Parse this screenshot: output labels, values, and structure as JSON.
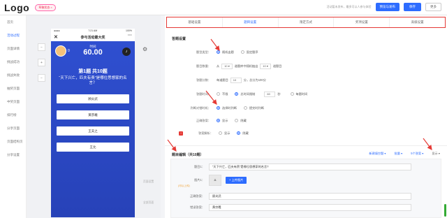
{
  "header": {
    "logo": "Logo",
    "draft_badge": "草稿状态 ×",
    "save_note": "活动暂未发布，最多可以人参与体验",
    "preview_publish": "预览与发布",
    "save": "保存",
    "more": "更多"
  },
  "sidebar": {
    "items": [
      {
        "label": "首页"
      },
      {
        "label": "活动过程",
        "active": true
      },
      {
        "label": "页面详情"
      },
      {
        "label": "挑战成功"
      },
      {
        "label": "挑战失败"
      },
      {
        "label": "抽奖页面"
      },
      {
        "label": "中奖页面"
      },
      {
        "label": "排行榜"
      },
      {
        "label": "分享页面"
      },
      {
        "label": "页面结构页"
      },
      {
        "label": "分享设置"
      }
    ]
  },
  "phone": {
    "status_time": "7:21 AM",
    "status_battery": "100%",
    "title": "参与活动最大奖",
    "score": "0",
    "time_label": "时间",
    "time_value": "60.00",
    "question_heading": "第1题  共10题",
    "question_text": "“天下兴亡，匹夫有责”是哪位思想家的名言？",
    "options": [
      "顾炎武",
      "黄宗羲",
      "王夫之",
      "王允"
    ]
  },
  "stage": {
    "side_btn_minus": "−",
    "side_btn_plus": "+",
    "label_bottom1": "页面设置",
    "label_bottom2": "全部页面"
  },
  "tabs": [
    {
      "label": "基础设置"
    },
    {
      "label": "题目设置",
      "active": true
    },
    {
      "label": "限定方式"
    },
    {
      "label": "奖项设置"
    },
    {
      "label": "高级设置"
    }
  ],
  "answer_settings": {
    "title": "答题设置",
    "question_type_label": "题型类型：",
    "question_type_options": [
      "随机出题",
      "固定题序"
    ],
    "count_label": "题目数量：",
    "count_prefix": "从",
    "count_value": "10",
    "count_middle": "道题库中随机抽出",
    "count_value2": "10",
    "count_suffix": "道题目",
    "score_label": "答题分数：",
    "score_prefix": "每道题目",
    "score_value": "10",
    "score_suffix": "分，总分为100分",
    "time_label": "答题时间：",
    "time_options": [
      "不限",
      "总时间限制",
      "每题时间"
    ],
    "time_value": "60",
    "time_unit": "秒",
    "judge_label": "判断对错时机：",
    "judge_options": [
      "选择时判断",
      "提交时判断"
    ],
    "correct_label": "正确答案：",
    "correct_options": [
      "显示",
      "隐藏"
    ],
    "analysis_label": "答案解析：",
    "analysis_options": [
      "显示",
      "隐藏"
    ]
  },
  "question_list": {
    "title": "题目编辑（共10题）",
    "actions": [
      "新建填空题 ▾",
      "批量 ▾",
      "5个答案 ▾",
      "显示 ▾"
    ],
    "question_label": "题目1：",
    "question_value": "“天下兴亡，匹夫有责”是哪位思想家的名言?",
    "image_label": "图片1：",
    "image_hint": "(可以上传)",
    "upload_label": "+ 上传图片",
    "correct_label": "正确答案：",
    "correct_value": "顾炎武",
    "wrong_label": "错误答案：",
    "wrong_value": "黄宗羲"
  },
  "colors": {
    "accent": "#2d6cff",
    "highlight_border": "#e53935",
    "phone_bg": "#2944b8"
  }
}
